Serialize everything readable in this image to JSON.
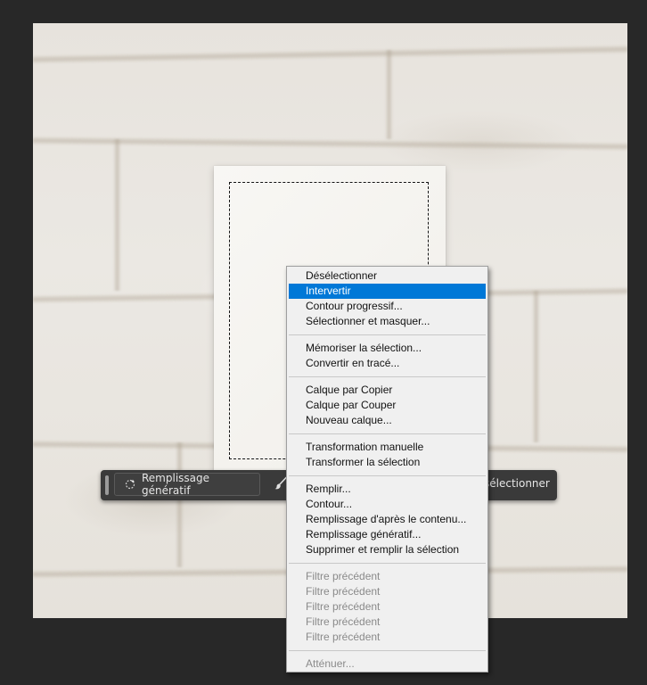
{
  "taskbar": {
    "generative_fill_label": "Remplissage génératif",
    "deselect_label": "sélectionner"
  },
  "context_menu": {
    "groups": [
      [
        {
          "label": "Désélectionner",
          "state": "normal"
        },
        {
          "label": "Intervertir",
          "state": "highlighted"
        },
        {
          "label": "Contour progressif...",
          "state": "normal"
        },
        {
          "label": "Sélectionner et masquer...",
          "state": "normal"
        }
      ],
      [
        {
          "label": "Mémoriser la sélection...",
          "state": "normal"
        },
        {
          "label": "Convertir en tracé...",
          "state": "normal"
        }
      ],
      [
        {
          "label": "Calque par Copier",
          "state": "normal"
        },
        {
          "label": "Calque par Couper",
          "state": "normal"
        },
        {
          "label": "Nouveau calque...",
          "state": "normal"
        }
      ],
      [
        {
          "label": "Transformation manuelle",
          "state": "normal"
        },
        {
          "label": "Transformer la sélection",
          "state": "normal"
        }
      ],
      [
        {
          "label": "Remplir...",
          "state": "normal"
        },
        {
          "label": "Contour...",
          "state": "normal"
        },
        {
          "label": "Remplissage d'après le contenu...",
          "state": "normal"
        },
        {
          "label": "Remplissage génératif...",
          "state": "normal"
        },
        {
          "label": "Supprimer et remplir la sélection",
          "state": "normal"
        }
      ],
      [
        {
          "label": "Filtre précédent",
          "state": "disabled"
        },
        {
          "label": "Filtre précédent",
          "state": "disabled"
        },
        {
          "label": "Filtre précédent",
          "state": "disabled"
        },
        {
          "label": "Filtre précédent",
          "state": "disabled"
        },
        {
          "label": "Filtre précédent",
          "state": "disabled"
        }
      ],
      [
        {
          "label": "Atténuer...",
          "state": "disabled"
        }
      ]
    ]
  },
  "icons": {
    "generative_fill": "sparkle-icon",
    "brush": "brush-icon"
  },
  "colors": {
    "workspace_bg": "#282828",
    "menu_bg": "#f0f0f0",
    "menu_highlight": "#0078d7",
    "taskbar_bg": "#3a3a3a"
  }
}
